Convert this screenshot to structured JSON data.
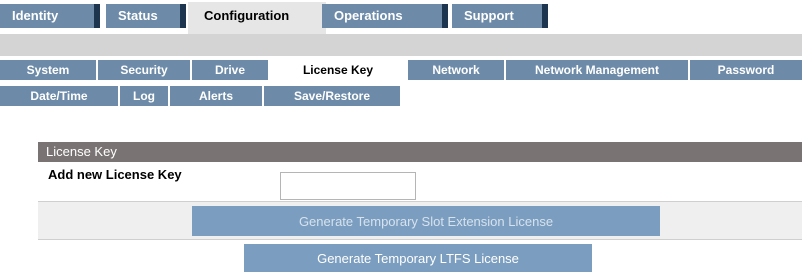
{
  "top_tabs": [
    {
      "label": "Identity",
      "active": false
    },
    {
      "label": "Status",
      "active": false
    },
    {
      "label": "Configuration",
      "active": true
    },
    {
      "label": "Operations",
      "active": false
    },
    {
      "label": "Support",
      "active": false
    }
  ],
  "sub_tabs_row1": [
    "System",
    "Security",
    "Drive",
    "License Key",
    "Network",
    "Network Management",
    "Password"
  ],
  "sub_tabs_row2": [
    "Date/Time",
    "Log",
    "Alerts",
    "Save/Restore"
  ],
  "active_sub_tab": "License Key",
  "panel": {
    "title": "License Key",
    "add_key_label": "Add new License Key",
    "add_key_value": "",
    "btn_slot_extension": "Generate Temporary Slot Extension License",
    "btn_ltfs": "Generate Temporary LTFS License"
  },
  "colors": {
    "tab_blue": "#6d8ba8",
    "tab_dark_edge": "#1e3550",
    "panel_header": "#7a7373",
    "button_blue": "#7b9dbf"
  }
}
